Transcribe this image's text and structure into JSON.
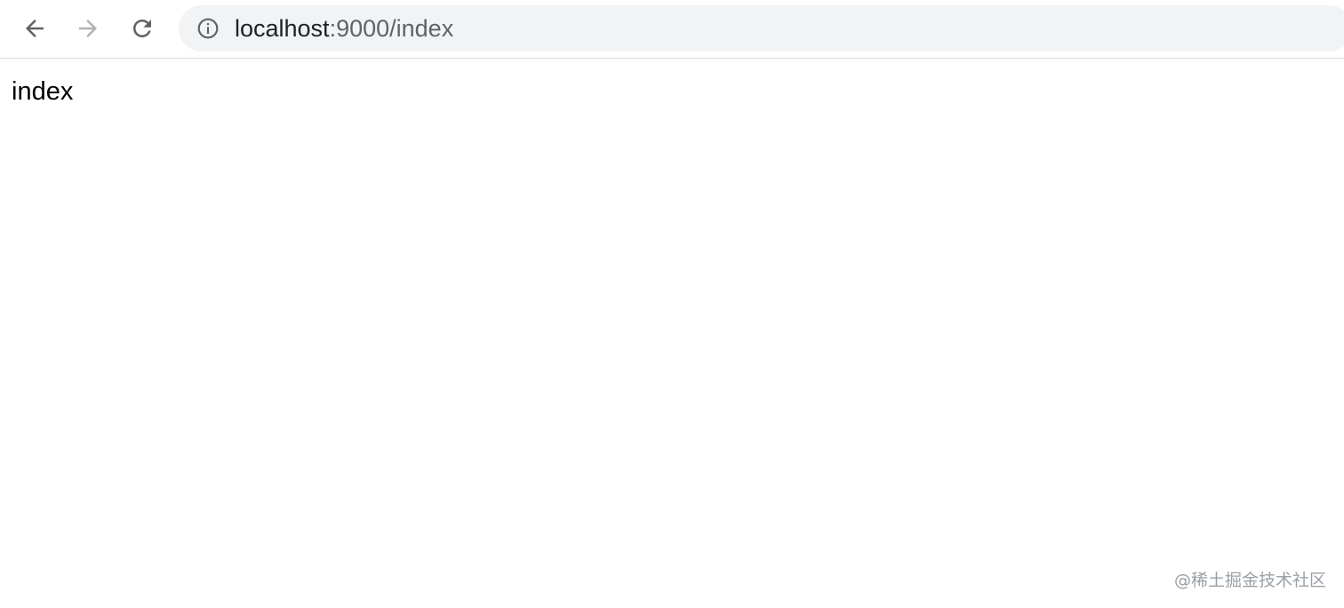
{
  "browser": {
    "back_button": {
      "icon": "arrow-left-icon",
      "enabled": true
    },
    "forward_button": {
      "icon": "arrow-right-icon",
      "enabled": false
    },
    "reload_button": {
      "icon": "reload-icon"
    },
    "address_bar": {
      "security_icon": "info-circle-icon",
      "host": "localhost",
      "rest": ":9000/index"
    }
  },
  "page": {
    "body_text": "index"
  },
  "watermark": {
    "text": "@稀土掘金技术社区"
  },
  "colors": {
    "toolbar_bg": "#ffffff",
    "omnibox_bg": "#f1f3f4",
    "icon_active": "#5f6368",
    "icon_disabled": "#b0b3b6",
    "url_host": "#202124",
    "url_rest": "#5f6368"
  }
}
